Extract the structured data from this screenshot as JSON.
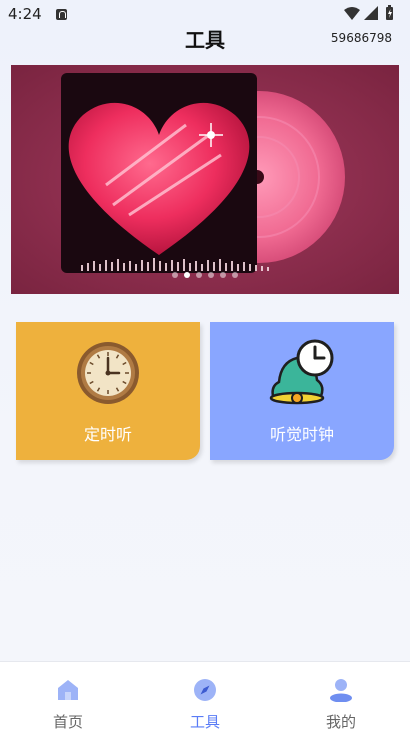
{
  "status_bar": {
    "time": "4:24"
  },
  "header": {
    "title": "工具",
    "right_text": "59686798"
  },
  "banner": {
    "slide_count": 6,
    "active_slide": 1
  },
  "cards": [
    {
      "label": "定时听",
      "icon": "wall-clock-icon",
      "color": "#eeb13d"
    },
    {
      "label": "听觉时钟",
      "icon": "bell-clock-icon",
      "color": "#89a6ff"
    }
  ],
  "tabbar": {
    "items": [
      {
        "label": "首页",
        "icon": "home-icon"
      },
      {
        "label": "工具",
        "icon": "compass-icon",
        "active": true
      },
      {
        "label": "我的",
        "icon": "person-icon"
      }
    ],
    "active_color": "#5a7cf6"
  }
}
